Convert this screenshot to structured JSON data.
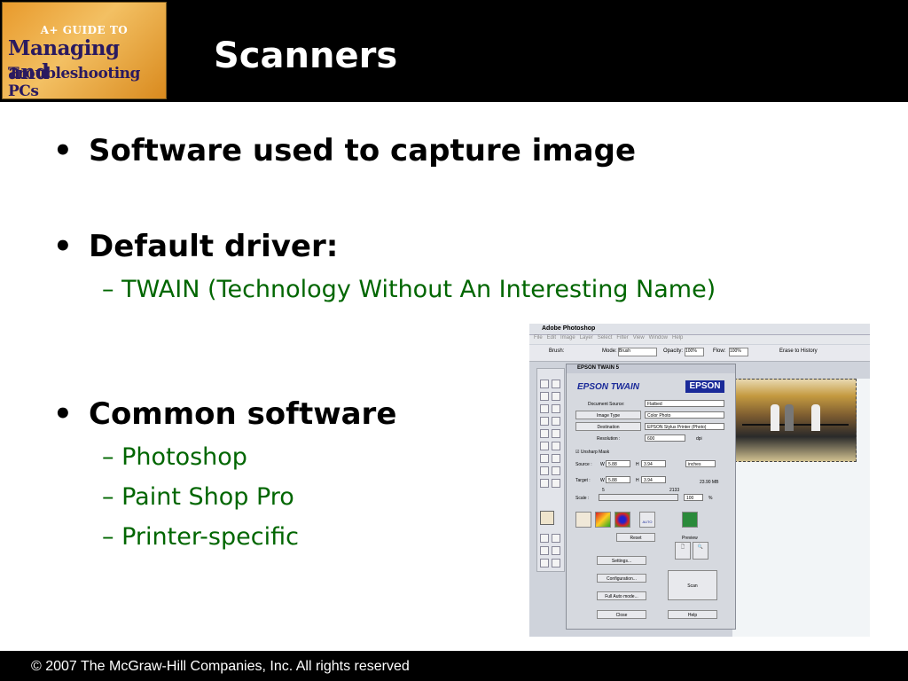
{
  "header": {
    "logo": {
      "line1": "A+ GUIDE TO",
      "line2": "Managing and",
      "line3": "Troubleshooting PCs"
    },
    "title": "Scanners"
  },
  "content": {
    "bullets": [
      {
        "text": "Software used to capture image",
        "subs": []
      },
      {
        "text": "Default driver:",
        "subs": [
          "TWAIN (Technology Without An Interesting Name)"
        ]
      },
      {
        "text": "Common software",
        "subs": [
          "Photoshop",
          "Paint Shop Pro",
          "Printer-specific"
        ]
      }
    ],
    "bullet_char": "•",
    "dash_char": "–"
  },
  "screenshot": {
    "app_title": "Adobe Photoshop",
    "menu": [
      "File",
      "Edit",
      "Image",
      "Layer",
      "Select",
      "Filter",
      "View",
      "Window",
      "Help"
    ],
    "options": {
      "brush": "Brush:",
      "mode_label": "Mode:",
      "mode": "Brush",
      "opacity_label": "Opacity:",
      "opacity": "100%",
      "flow_label": "Flow:",
      "flow": "100%",
      "erase": "Erase to History"
    },
    "twain": {
      "window_title": "EPSON TWAIN 5",
      "brand_title": "EPSON TWAIN",
      "logo": "EPSON",
      "doc_source_label": "Document Source:",
      "doc_source": "Flatbed",
      "image_type_label": "Image Type",
      "image_type": "Color Photo",
      "destination_label": "Destination",
      "destination": "EPSON Stylus Printer (Photo)",
      "resolution_label": "Resolution :",
      "resolution": "600",
      "resolution_unit": "dpi",
      "unsharp": "Unsharp Mask",
      "source_label": "Source :",
      "w_label": "W",
      "source_w": "5.88",
      "h_label": "H",
      "source_h": "3.94",
      "units": "inches",
      "target_label": "Target :",
      "target_w": "5.88",
      "target_h": "3.94",
      "size": "23.90 MB",
      "scale_label": "Scale :",
      "scale_min": "5",
      "scale_max": "2133",
      "scale": "100",
      "scale_unit": "%",
      "auto": "AUTO",
      "reset": "Reset",
      "preview": "Preview",
      "settings": "Settings...",
      "configuration": "Configuration...",
      "full_auto": "Full Auto mode...",
      "scan": "Scan",
      "close": "Close",
      "help": "Help"
    }
  },
  "footer": {
    "text": "© 2007 The McGraw-Hill Companies, Inc. All rights reserved"
  },
  "colors": {
    "header_bg": "#000000",
    "subtext": "#006600",
    "epson_blue": "#1a2a99"
  }
}
